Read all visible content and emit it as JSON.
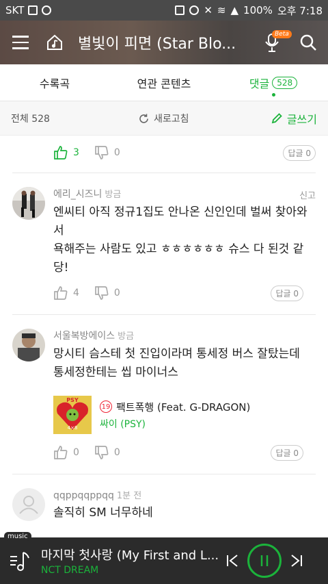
{
  "status_bar": {
    "carrier": "SKT",
    "battery": "100%",
    "time": "오후 7:18"
  },
  "header": {
    "title": "별빛이 피면 (Star Blo...",
    "beta_badge": "Beta"
  },
  "tabs": [
    {
      "label": "수록곡"
    },
    {
      "label": "연관 콘텐츠"
    },
    {
      "label": "댓글",
      "count": "528"
    }
  ],
  "subheader": {
    "total": "전체 528",
    "refresh": "새로고침",
    "write": "글쓰기"
  },
  "top_actions": {
    "likes": "3",
    "dislikes": "0",
    "reply": "답글 0"
  },
  "comments": [
    {
      "author": "에리_시즈니",
      "time": "방금",
      "report": "신고",
      "text": "엔씨티 아직 정규1집도 안나온 신인인데 벌써 찾아와서\n욕해주는 사람도 있고 ㅎㅎㅎㅎㅎㅎ 슈스 다 된것 같당!",
      "likes": "4",
      "dislikes": "0",
      "reply": "답글 0"
    },
    {
      "author": "서울복방에이스",
      "time": "방금",
      "text": "망시티 슴스테 첫 진입이라며 통세정 버스 잘탔는데\n통세정한테는 씹 마이너스",
      "song": {
        "age_badge": "19",
        "title": "팩트폭행 (Feat. G-DRAGON)",
        "artist": "싸이 (PSY)",
        "album_text": "PSY"
      },
      "likes": "0",
      "dislikes": "0",
      "reply": "답글 0"
    },
    {
      "author": "qqppqqppqq",
      "time": "1분 전",
      "text": "솔직히 SM 너무하네\n\n다른 소속사 가수 대려다 써놓고\n\nSM STATION 딱 박아놓고"
    }
  ],
  "player": {
    "tag": "music",
    "title": "마지막 첫사랑 (My First and L...",
    "artist": "NCT DREAM"
  },
  "colors": {
    "accent": "#1bb33b",
    "player_bg": "#2b2b2b",
    "statusbar": "#4a4a4a"
  }
}
